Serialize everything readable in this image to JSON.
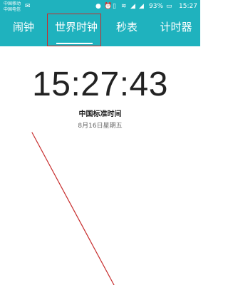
{
  "status_bar": {
    "carrier_1": "中国移动",
    "carrier_2": "中国电信",
    "battery_text": "93%",
    "time": "15:27",
    "icons": {
      "message": "message-icon",
      "location": "location-icon",
      "alarm": "alarm-icon",
      "vibrate": "vibrate-icon",
      "wifi": "wifi-icon",
      "signal": "signal-icon",
      "battery": "battery-icon"
    }
  },
  "tabs": [
    {
      "label": "闹钟"
    },
    {
      "label": "世界时钟"
    },
    {
      "label": "秒表"
    },
    {
      "label": "计时器"
    }
  ],
  "clock": {
    "time": "15:27:43",
    "timezone": "中国标准时间",
    "date": "8月16日星期五"
  },
  "colors": {
    "header": "#1fb2be",
    "annotation": "#c72d2d"
  }
}
